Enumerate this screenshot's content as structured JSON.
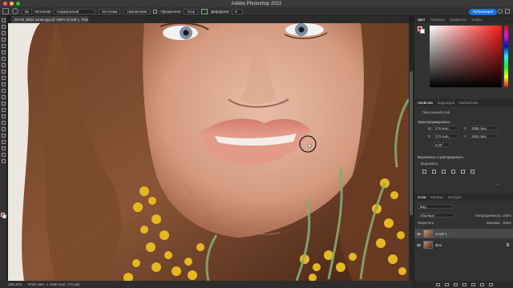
{
  "window": {
    "title": "Adobe Photoshop 2022",
    "traffic_colors": [
      "#ff5f57",
      "#febc2e",
      "#28c840"
    ]
  },
  "options_bar": {
    "home_icon": "home-icon",
    "brush_size": "65",
    "mode_label": "Источник",
    "mode_value": "Нормальный",
    "sample_label": "Источник",
    "sample_value": "Назначение",
    "transparent_label": "Прозрачное",
    "use_label": "Узор",
    "diffusion_label": "Диффузия",
    "diffusion_value": "5",
    "share_button": "Публикация"
  },
  "document": {
    "tab_title": "0CAN_9532 копия.jpg @ 106% (Слой 1, RGB/8*) *"
  },
  "status": {
    "zoom": "106,43%",
    "doc_size": "6783 пикс. x 4480 пикс. (72 ppi)"
  },
  "colors": {
    "foreground": "#c81818",
    "background": "#ffffff",
    "accent": "#1473e6"
  },
  "color_panel": {
    "tabs": [
      "Цвет",
      "Образцы",
      "Градиенты",
      "Узоры"
    ]
  },
  "properties_panel": {
    "tabs": [
      "Свойства",
      "Коррекция",
      "Библиотеки"
    ],
    "layer_kind": "Пиксельный слой",
    "transform_header": "Трансформировать",
    "w_label": "Ш",
    "w_value": "276 пикс.",
    "h_label": "В",
    "h_value": "374 пикс.",
    "x_label": "X",
    "x_value": "3366 пикс.",
    "y_label": "Y",
    "y_value": "1804 пикс.",
    "angle_value": "0,00°",
    "align_header": "Выровнять и распределить",
    "align_sub": "Выровнять:"
  },
  "layers_panel": {
    "tabs": [
      "Слои",
      "Каналы",
      "Контуры"
    ],
    "search_placeholder": "Вид",
    "blend_mode": "Обычные",
    "opacity_label": "Непрозрачность:",
    "opacity_value": "100%",
    "lock_label": "Закрепить:",
    "fill_label": "Заливка:",
    "fill_value": "100%",
    "layers": [
      {
        "name": "Слой 1"
      },
      {
        "name": "Фон"
      }
    ]
  }
}
